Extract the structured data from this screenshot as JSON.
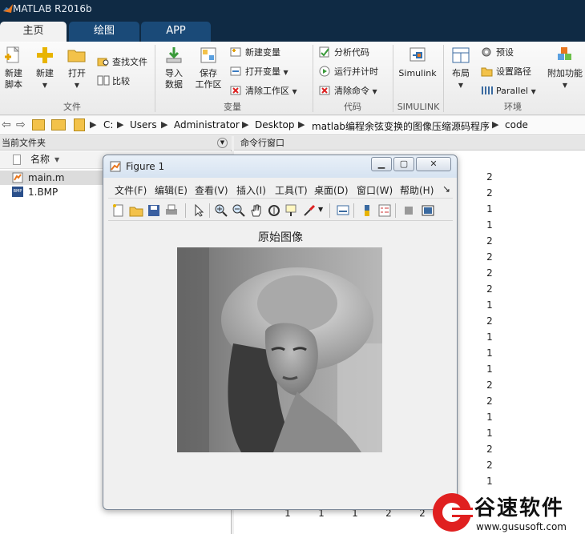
{
  "app": {
    "title": "MATLAB R2016b"
  },
  "tabs": [
    {
      "label": "主页"
    },
    {
      "label": "绘图"
    },
    {
      "label": "APP"
    }
  ],
  "ribbon": {
    "file": {
      "label": "文件",
      "new_script": "新建\n脚本",
      "new": "新建",
      "open": "打开",
      "find_files": "查找文件",
      "compare": "比较"
    },
    "variable": {
      "label": "变量",
      "import": "导入\n数据",
      "save_ws": "保存\n工作区",
      "new_var": "新建变量",
      "open_var": "打开变量",
      "clear_ws": "清除工作区"
    },
    "code": {
      "label": "代码",
      "analyze": "分析代码",
      "run_time": "运行并计时",
      "clear_cmd": "清除命令"
    },
    "simulink": {
      "label": "SIMULINK",
      "btn": "Simulink"
    },
    "env": {
      "label": "环境",
      "layout": "布局",
      "prefs": "预设",
      "set_path": "设置路径",
      "parallel": "Parallel",
      "addons": "附加功能"
    }
  },
  "address": {
    "crumbs": [
      "C:",
      "Users",
      "Administrator",
      "Desktop",
      "matlab编程余弦变换的图像压缩源码程序",
      "code"
    ]
  },
  "left_panel": {
    "title": "当前文件夹",
    "col_name": "名称",
    "files": [
      {
        "name": "main.m",
        "selected": true
      },
      {
        "name": "1.BMP",
        "selected": false
      }
    ]
  },
  "command_window": {
    "title": "命令行窗口",
    "col_values": [
      "2",
      "2",
      "1",
      "1",
      "2",
      "2",
      "2",
      "2",
      "1",
      "2",
      "1",
      "1",
      "1",
      "2",
      "2",
      "1",
      "1",
      "2",
      "2",
      "1"
    ],
    "bottom_row": [
      "1",
      "1",
      "1",
      "2",
      "2"
    ]
  },
  "figure": {
    "title": "Figure 1",
    "menu": [
      "文件(F)",
      "编辑(E)",
      "查看(V)",
      "插入(I)",
      "工具(T)",
      "桌面(D)",
      "窗口(W)",
      "帮助(H)"
    ],
    "axes_title": "原始图像"
  },
  "watermark": {
    "name": "谷速软件",
    "url": "www.gususoft.com",
    "colors": {
      "accent": "#e02020"
    }
  }
}
